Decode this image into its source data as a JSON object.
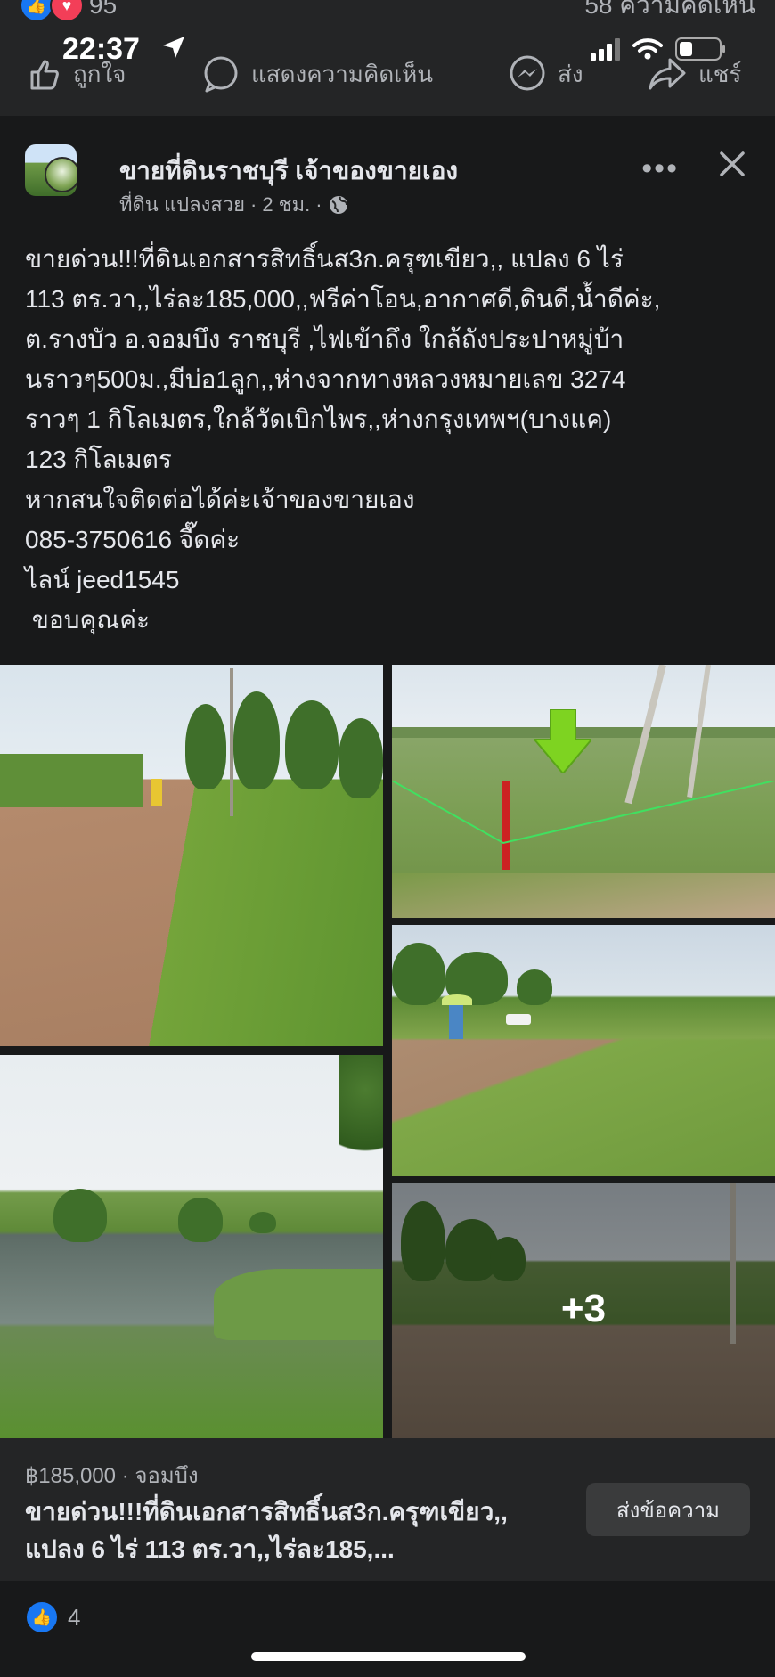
{
  "topbar": {
    "reaction_count": "95",
    "comment_count": "58 ความคิดเห็น",
    "time": "22:37",
    "actions": {
      "like": "ถูกใจ",
      "comment": "แสดงความคิดเห็น",
      "send": "ส่ง",
      "share": "แชร์"
    }
  },
  "post": {
    "page_name": "ขายที่ดินราชบุรี เจ้าของขายเอง",
    "author": "ที่ดิน แปลงสวย",
    "age": "2 ชม.",
    "text": "ขายด่วน!!!ที่ดินเอกสารสิทธิ์นส3ก.ครุฑเขียว,, แปลง 6 ไร่\n113 ตร.วา,,ไร่ละ185,000,,ฟรีค่าโอน,อากาศดี,ดินดี,น้ำดีค่ะ,\nต.รางบัว อ.จอมบึง ราชบุรี ,ไฟเข้าถึง ใกล้ถังประปาหมู่บ้า\nนราวๆ500ม.,มีบ่อ1ลูก,,ห่างจากทางหลวงหมายเลข 3274\nราวๆ 1 กิโลเมตร,ใกล้วัดเบิกไพร,,ห่างกรุงเทพฯ(บางแค)\n123 กิโลเมตร\nหากสนใจติดต่อได้ค่ะเจ้าของขายเอง\n085-3750616 จี๊ดค่ะ\nไลน์ jeed1545\n ขอบคุณค่ะ",
    "more_photos": "+3"
  },
  "listing": {
    "price_location": "฿185,000 · จอมบึง",
    "title": "ขายด่วน!!!ที่ดินเอกสารสิทธิ์นส3ก.ครุฑเขียว,, แปลง 6 ไร่ 113 ตร.วา,,ไร่ละ185,...",
    "message_button": "ส่งข้อความ"
  },
  "footer": {
    "like_count": "4"
  },
  "colors": {
    "background": "#18191a",
    "card": "#242526",
    "like_blue": "#1877f2",
    "love_red": "#f33e58"
  }
}
